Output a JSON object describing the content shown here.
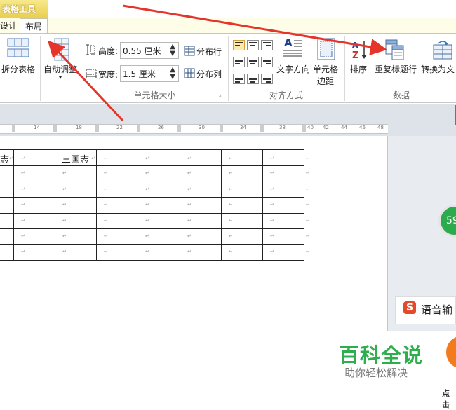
{
  "ribbon": {
    "context_title": "表格工具",
    "tabs": {
      "design": "设计",
      "layout": "布局"
    },
    "split_table": "拆分表格",
    "autofit": "自动调整",
    "height_label": "高度:",
    "height_value": "0.55 厘米",
    "width_label": "宽度:",
    "width_value": "1.5 厘米",
    "distribute_rows": "分布行",
    "distribute_cols": "分布列",
    "group_cell_size": "单元格大小",
    "text_direction": "文字方向",
    "cell_margins_line1": "单元格",
    "cell_margins_line2": "边距",
    "group_alignment": "对齐方式",
    "sort": "排序",
    "repeat_header": "重复标题行",
    "convert_to_text": "转换为文",
    "group_data": "数据"
  },
  "ruler": {
    "numbers": [
      "14",
      "18",
      "22",
      "26",
      "30",
      "34",
      "38",
      "40",
      "42",
      "44",
      "46",
      "48"
    ]
  },
  "document": {
    "cell_a1": "志",
    "cell_b1": "三国志",
    "paragraph_mark": "↵"
  },
  "side": {
    "green_badge": "59",
    "voice_label": "语音输",
    "watermark_title": "百科全说",
    "watermark_sub": "助你轻松解决",
    "tap_text": "点击"
  },
  "colors": {
    "context_tab_yellow": "#e9cf4d",
    "arrow_red": "#e5352b",
    "watermark_green": "#2fae4d"
  }
}
